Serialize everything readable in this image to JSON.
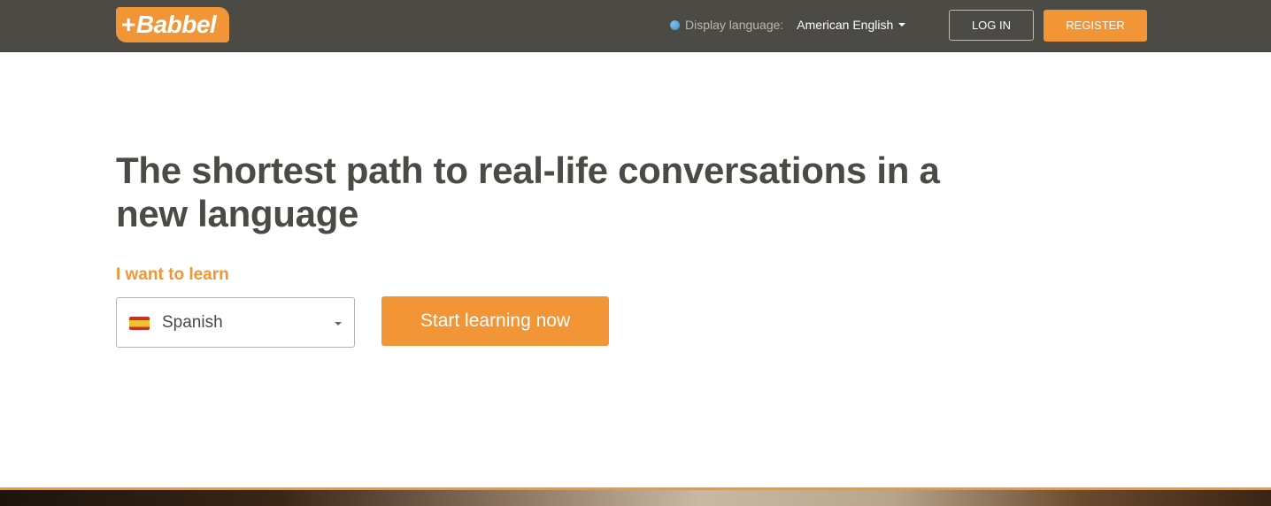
{
  "header": {
    "logo_text": "Babbel",
    "logo_plus": "+",
    "display_language_label": "Display language:",
    "display_language_value": "American English",
    "login_label": "LOG IN",
    "register_label": "REGISTER"
  },
  "hero": {
    "headline": "The shortest path to real-life conversations in a new language",
    "learn_label": "I want to learn",
    "language_select": {
      "selected": "Spanish",
      "flag_icon": "spain-flag-icon"
    },
    "cta_label": "Start learning now"
  },
  "colors": {
    "accent": "#f29537",
    "header_bg": "#4b4a44",
    "text_dark": "#4b4a44"
  }
}
